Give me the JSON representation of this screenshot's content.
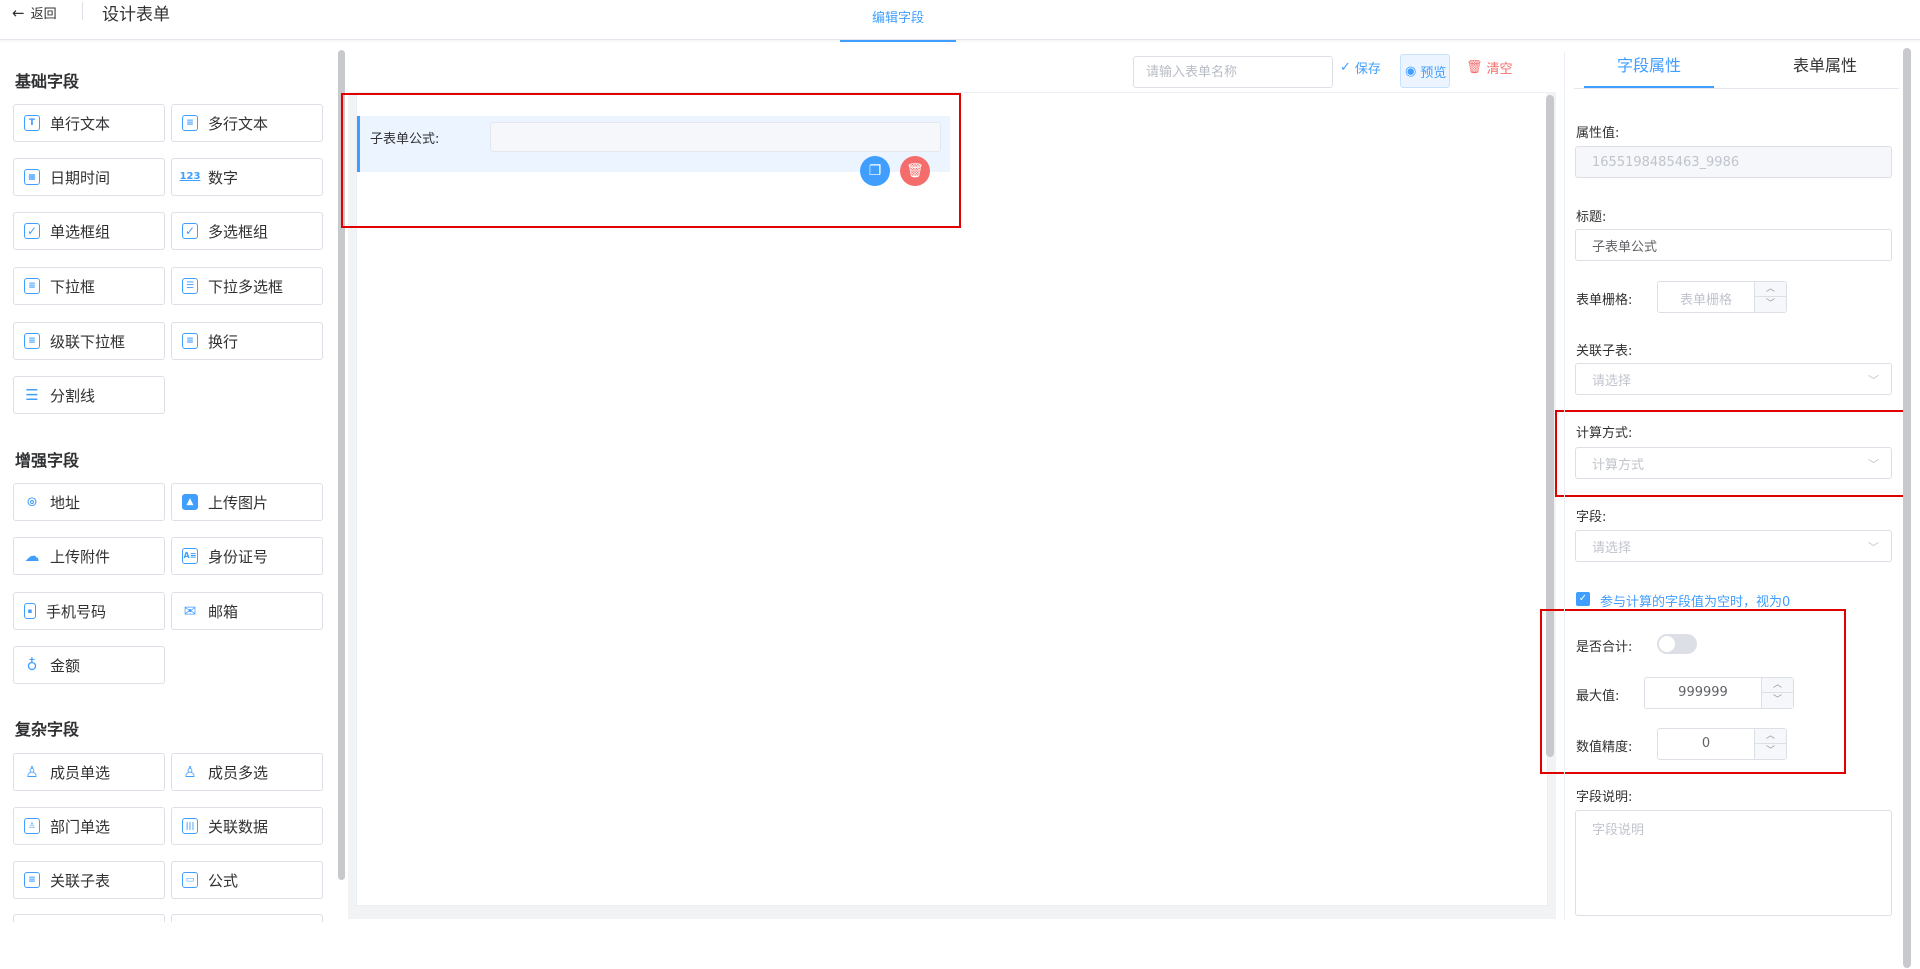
{
  "header": {
    "back_label": "返回",
    "title": "设计表单",
    "active_tab": "编辑字段"
  },
  "palette": {
    "groups": [
      {
        "title": "基础字段",
        "items": [
          {
            "label": "单行文本",
            "icon": "text-input-icon"
          },
          {
            "label": "多行文本",
            "icon": "textarea-icon"
          },
          {
            "label": "日期时间",
            "icon": "calendar-icon"
          },
          {
            "label": "数字",
            "icon": "number-icon"
          },
          {
            "label": "单选框组",
            "icon": "radio-icon"
          },
          {
            "label": "多选框组",
            "icon": "checkbox-icon"
          },
          {
            "label": "下拉框",
            "icon": "select-icon"
          },
          {
            "label": "下拉多选框",
            "icon": "multi-select-icon"
          },
          {
            "label": "级联下拉框",
            "icon": "cascader-icon"
          },
          {
            "label": "换行",
            "icon": "line-break-icon"
          },
          {
            "label": "分割线",
            "icon": "divider-icon"
          }
        ]
      },
      {
        "title": "增强字段",
        "items": [
          {
            "label": "地址",
            "icon": "location-icon"
          },
          {
            "label": "上传图片",
            "icon": "image-icon"
          },
          {
            "label": "上传附件",
            "icon": "upload-cloud-icon"
          },
          {
            "label": "身份证号",
            "icon": "id-card-icon"
          },
          {
            "label": "手机号码",
            "icon": "mobile-icon"
          },
          {
            "label": "邮箱",
            "icon": "mail-icon"
          },
          {
            "label": "金额",
            "icon": "money-bag-icon"
          }
        ]
      },
      {
        "title": "复杂字段",
        "items": [
          {
            "label": "成员单选",
            "icon": "user-icon"
          },
          {
            "label": "成员多选",
            "icon": "users-icon"
          },
          {
            "label": "部门单选",
            "icon": "department-icon"
          },
          {
            "label": "关联数据",
            "icon": "related-data-icon"
          },
          {
            "label": "关联子表",
            "icon": "subtable-icon"
          },
          {
            "label": "公式",
            "icon": "formula-icon"
          }
        ]
      }
    ]
  },
  "toolbar": {
    "form_name_placeholder": "请输入表单名称",
    "save_label": "保存",
    "preview_label": "预览",
    "clear_label": "清空"
  },
  "canvas": {
    "field_label": "子表单公式:"
  },
  "properties": {
    "tabs": [
      "字段属性",
      "表单属性"
    ],
    "attr_value_label": "属性值:",
    "attr_value": "1655198485463_9986",
    "title_label": "标题:",
    "title_value": "子表单公式",
    "grid_label": "表单栅格:",
    "grid_placeholder": "表单栅格",
    "subtable_label": "关联子表:",
    "subtable_placeholder": "请选择",
    "calc_label": "计算方式:",
    "calc_placeholder": "计算方式",
    "field_label": "字段:",
    "field_placeholder": "请选择",
    "empty_as_zero_label": "参与计算的字段值为空时，视为0",
    "empty_as_zero_checked": true,
    "sum_label": "是否合计:",
    "sum_enabled": false,
    "max_label": "最大值:",
    "max_value": "999999",
    "precision_label": "数值精度:",
    "precision_value": "0",
    "desc_label": "字段说明:",
    "desc_placeholder": "字段说明"
  },
  "colors": {
    "accent": "#409eff",
    "danger": "#f56c6c",
    "highlight_box": "#e00000"
  }
}
